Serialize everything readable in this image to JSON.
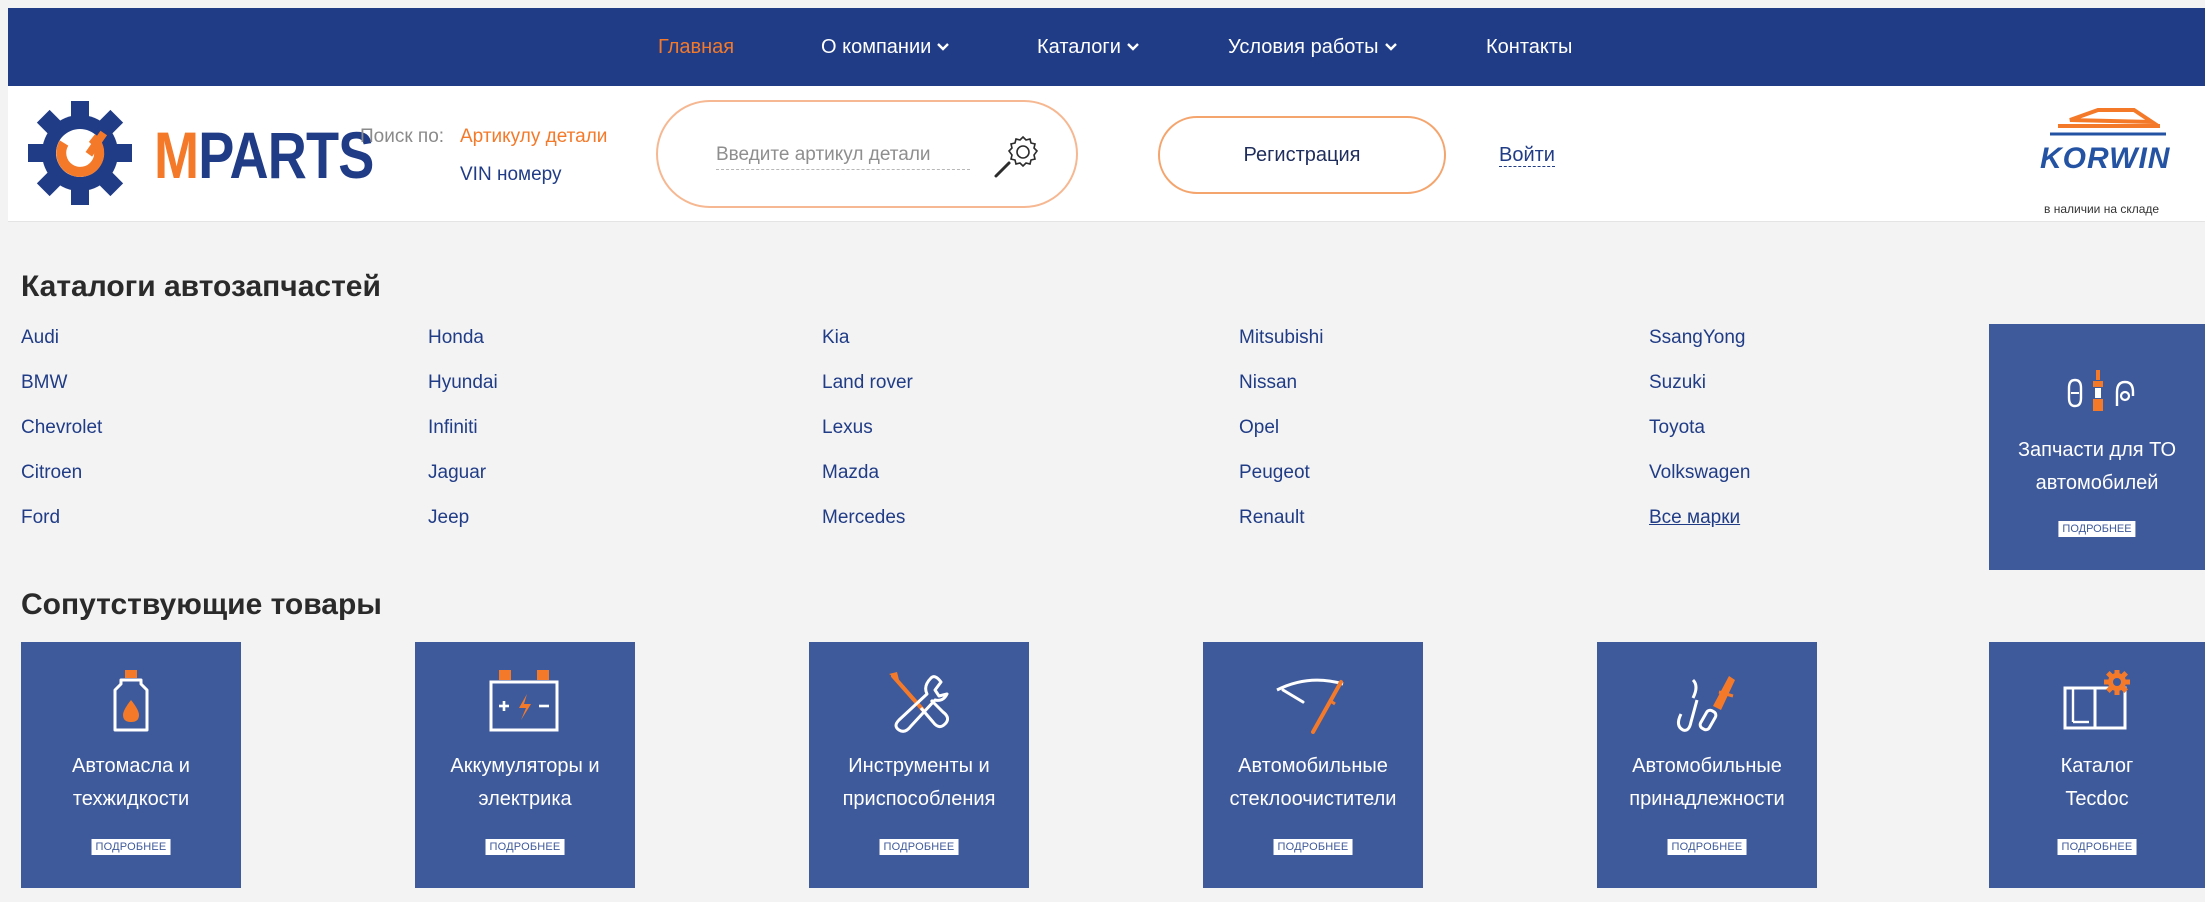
{
  "nav": {
    "items": [
      {
        "label": "Главная",
        "active": true,
        "dropdown": false
      },
      {
        "label": "О компании",
        "active": false,
        "dropdown": true
      },
      {
        "label": "Каталоги",
        "active": false,
        "dropdown": true
      },
      {
        "label": "Условия работы",
        "active": false,
        "dropdown": true
      },
      {
        "label": "Контакты",
        "active": false,
        "dropdown": false
      }
    ]
  },
  "header": {
    "logo_text": {
      "first": "M",
      "rest": "PARTS"
    },
    "search_by_label": "Поиск по:",
    "search_options": [
      "Артикулу детали",
      "VIN номеру"
    ],
    "search_placeholder": "Введите артикул детали",
    "register_label": "Регистрация",
    "login_label": "Войти",
    "partner_logo": "KORWIN",
    "partner_caption": "в наличии на складе"
  },
  "catalogs": {
    "title": "Каталоги автозапчастей",
    "columns": [
      [
        "Audi",
        "BMW",
        "Chevrolet",
        "Citroen",
        "Ford"
      ],
      [
        "Honda",
        "Hyundai",
        "Infiniti",
        "Jaguar",
        "Jeep"
      ],
      [
        "Kia",
        "Land rover",
        "Lexus",
        "Mazda",
        "Mercedes"
      ],
      [
        "Mitsubishi",
        "Nissan",
        "Opel",
        "Peugeot",
        "Renault"
      ],
      [
        "SsangYong",
        "Suzuki",
        "Toyota",
        "Volkswagen",
        "Все марки"
      ]
    ],
    "to_tile": {
      "label_line1": "Запчасти для ТО",
      "label_line2": "автомобилей",
      "more": "ПОДРОБНЕЕ",
      "icon": "spark-plug-icon"
    }
  },
  "related": {
    "title": "Сопутствующие товары",
    "tiles": [
      {
        "line1": "Автомасла и",
        "line2": "техжидкости",
        "more": "ПОДРОБНЕЕ",
        "icon": "oil-canister-icon"
      },
      {
        "line1": "Аккумуляторы и",
        "line2": "электрика",
        "more": "ПОДРОБНЕЕ",
        "icon": "battery-icon"
      },
      {
        "line1": "Инструменты и",
        "line2": "приспособления",
        "more": "ПОДРОБНЕЕ",
        "icon": "tools-icon"
      },
      {
        "line1": "Автомобильные",
        "line2": "стеклоочистители",
        "more": "ПОДРОБНЕЕ",
        "icon": "wiper-icon"
      },
      {
        "line1": "Автомобильные",
        "line2": "принадлежности",
        "more": "ПОДРОБНЕЕ",
        "icon": "jumper-cables-icon"
      },
      {
        "line1": "Каталог",
        "line2": "Tecdoc",
        "more": "ПОДРОБНЕЕ",
        "icon": "catalog-book-icon"
      }
    ]
  },
  "colors": {
    "nav_bg": "#203c86",
    "accent": "#f47a2a",
    "tile_bg": "#3f5a9b",
    "page_bg": "#f3f3f3"
  }
}
